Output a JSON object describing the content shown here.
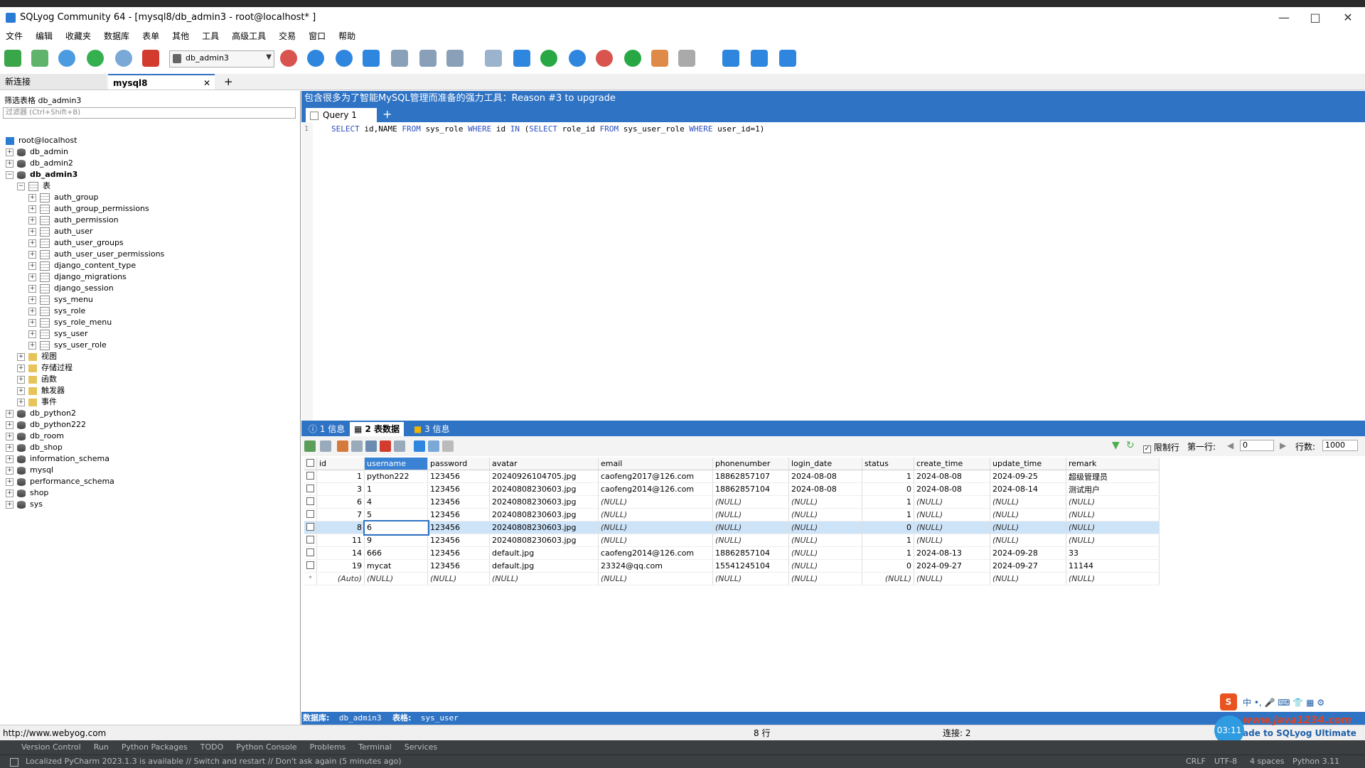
{
  "window": {
    "title": "SQLyog Community 64 - [mysql8/db_admin3 - root@localhost* ]"
  },
  "menu": [
    "文件",
    "编辑",
    "收藏夹",
    "数据库",
    "表单",
    "其他",
    "工具",
    "高级工具",
    "交易",
    "窗口",
    "帮助"
  ],
  "toolbar": {
    "db_selector": "db_admin3"
  },
  "connection_tabs": [
    {
      "label": "新连接"
    },
    {
      "label": "mysql8"
    }
  ],
  "left": {
    "filter_label": "筛选表格 db_admin3",
    "filter_placeholder": "过滤器 (Ctrl+Shift+B)",
    "host": "root@localhost",
    "databases_top": [
      "db_admin",
      "db_admin2",
      "db_admin3"
    ],
    "tables_folder": "表",
    "tables": [
      "auth_group",
      "auth_group_permissions",
      "auth_permission",
      "auth_user",
      "auth_user_groups",
      "auth_user_user_permissions",
      "django_content_type",
      "django_migrations",
      "django_session",
      "sys_menu",
      "sys_role",
      "sys_role_menu",
      "sys_user",
      "sys_user_role"
    ],
    "folders": [
      "视图",
      "存储过程",
      "函数",
      "触发器",
      "事件"
    ],
    "databases_bottom": [
      "db_python2",
      "db_python222",
      "db_room",
      "db_shop",
      "information_schema",
      "mysql",
      "performance_schema",
      "shop",
      "sys"
    ]
  },
  "promo": "包含很多为了智能MySQL管理而准备的强力工具：Reason #3 to upgrade",
  "query_tab": "Query 1",
  "editor": {
    "line": "1",
    "sql_parts": [
      {
        "t": "SELECT",
        "k": true
      },
      {
        "t": " id,NAME ",
        "k": false
      },
      {
        "t": "FROM",
        "k": true
      },
      {
        "t": " sys_role ",
        "k": false
      },
      {
        "t": "WHERE",
        "k": true
      },
      {
        "t": " id ",
        "k": false
      },
      {
        "t": "IN",
        "k": true
      },
      {
        "t": " (",
        "k": false
      },
      {
        "t": "SELECT",
        "k": true
      },
      {
        "t": " role_id ",
        "k": false
      },
      {
        "t": "FROM",
        "k": true
      },
      {
        "t": " sys_user_role ",
        "k": false
      },
      {
        "t": "WHERE",
        "k": true
      },
      {
        "t": " user_id=1)",
        "k": false
      }
    ]
  },
  "result_tabs": [
    "1 信息",
    "2 表数据",
    "3 信息"
  ],
  "result_toolbar": {
    "limit_label": "限制行",
    "first_row_label": "第一行:",
    "first_row": "0",
    "rows_label": "行数:",
    "rows": "1000"
  },
  "grid": {
    "columns": [
      "id",
      "username",
      "password",
      "avatar",
      "email",
      "phonenumber",
      "login_date",
      "status",
      "create_time",
      "update_time",
      "remark"
    ],
    "rows": [
      [
        "1",
        "python222",
        "123456",
        "20240926104705.jpg",
        "caofeng2017@126.com",
        "18862857107",
        "2024-08-08",
        "1",
        "2024-08-08",
        "2024-09-25",
        "超级管理员"
      ],
      [
        "3",
        "1",
        "123456",
        "20240808230603.jpg",
        "caofeng2014@126.com",
        "18862857104",
        "2024-08-08",
        "0",
        "2024-08-08",
        "2024-08-14",
        "测试用户"
      ],
      [
        "6",
        "4",
        "123456",
        "20240808230603.jpg",
        "(NULL)",
        "(NULL)",
        "(NULL)",
        "1",
        "(NULL)",
        "(NULL)",
        "(NULL)"
      ],
      [
        "7",
        "5",
        "123456",
        "20240808230603.jpg",
        "(NULL)",
        "(NULL)",
        "(NULL)",
        "1",
        "(NULL)",
        "(NULL)",
        "(NULL)"
      ],
      [
        "8",
        "6",
        "123456",
        "20240808230603.jpg",
        "(NULL)",
        "(NULL)",
        "(NULL)",
        "0",
        "(NULL)",
        "(NULL)",
        "(NULL)"
      ],
      [
        "11",
        "9",
        "123456",
        "20240808230603.jpg",
        "(NULL)",
        "(NULL)",
        "(NULL)",
        "1",
        "(NULL)",
        "(NULL)",
        "(NULL)"
      ],
      [
        "14",
        "666",
        "123456",
        "default.jpg",
        "caofeng2014@126.com",
        "18862857104",
        "(NULL)",
        "1",
        "2024-08-13",
        "2024-09-28",
        "33"
      ],
      [
        "19",
        "mycat",
        "123456",
        "default.jpg",
        "23324@qq.com",
        "15541245104",
        "(NULL)",
        "0",
        "2024-09-27",
        "2024-09-27",
        "11144"
      ],
      [
        "(Auto)",
        "(NULL)",
        "(NULL)",
        "(NULL)",
        "(NULL)",
        "(NULL)",
        "(NULL)",
        "(NULL)",
        "(NULL)",
        "(NULL)",
        "(NULL)"
      ]
    ],
    "selected_row": 4
  },
  "status_inner": {
    "db_label": "数据库:",
    "db": "db_admin3",
    "table_label": "表格:",
    "table": "sys_user"
  },
  "bottom": {
    "url": "http://www.webyog.com",
    "rows": "8 行",
    "conn": "连接: 2",
    "upgrade": "ade to SQLyog Ultimate",
    "timer": "03:11"
  },
  "pycharm_tools": [
    "Version Control",
    "Run",
    "Python Packages",
    "TODO",
    "Python Console",
    "Problems",
    "Terminal",
    "Services"
  ],
  "pycharm_status": {
    "message": "Localized PyCharm 2023.1.3 is available // Switch and restart // Don't ask again (5 minutes ago)",
    "right": [
      "CRLF",
      "UTF-8",
      "4 spaces",
      "Python 3.11"
    ]
  },
  "watermark": "www.java1234.com",
  "colors": {
    "accent": "#2f73c4",
    "selected_row": "#cde3f8",
    "keyword": "#2c4fbf"
  }
}
